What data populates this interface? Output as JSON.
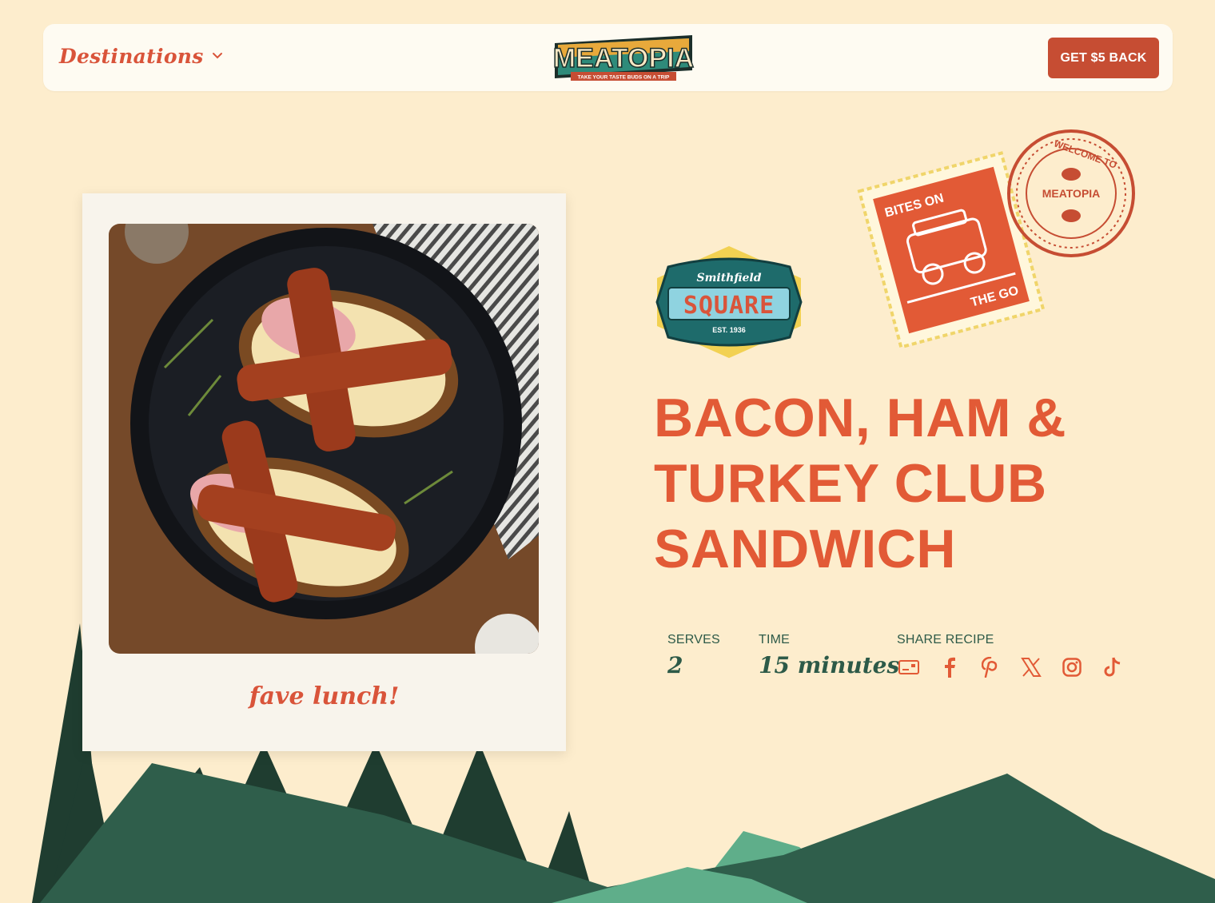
{
  "header": {
    "destinations_label": "Destinations",
    "logo_text": "MEATOPIA",
    "logo_tagline": "TAKE YOUR TASTE BUDS ON A TRIP",
    "cta_label": "GET $5 BACK"
  },
  "polaroid": {
    "caption": "fave lunch!"
  },
  "brand_badge": {
    "top": "Smithfield",
    "main": "SQUARE",
    "est": "EST. 1936"
  },
  "stamp": {
    "top": "BITES ON",
    "bottom": "THE GO"
  },
  "seal": {
    "ring": "WELCOME TO",
    "center": "MEATOPIA"
  },
  "recipe": {
    "title": "BACON, HAM & TURKEY CLUB SANDWICH",
    "serves_label": "SERVES",
    "serves_value": "2",
    "time_label": "TIME",
    "time_value": "15 minutes",
    "share_label": "SHARE RECIPE",
    "share_icons": [
      "email-card-icon",
      "facebook-icon",
      "pinterest-icon",
      "x-icon",
      "instagram-icon",
      "tiktok-icon"
    ]
  },
  "colors": {
    "background": "#fdedcd",
    "accent": "#e25a36",
    "button": "#c64d33",
    "forest_dark": "#1f3d30",
    "forest_mid": "#2f5e4b",
    "forest_light": "#5fae8a"
  }
}
